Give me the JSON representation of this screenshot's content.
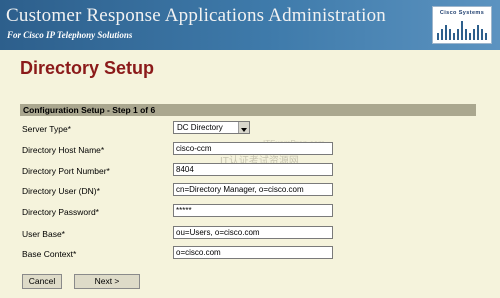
{
  "header": {
    "title": "Customer Response Applications Administration",
    "subtitle": "For Cisco IP Telephony Solutions",
    "logo_text": "Cisco Systems"
  },
  "page_title": "Directory Setup",
  "step_label": "Configuration Setup - Step 1 of 6",
  "form": {
    "server_type": {
      "label": "Server Type*",
      "value": "DC Directory"
    },
    "host_name": {
      "label": "Directory Host Name*",
      "value": "cisco-ccm"
    },
    "port_number": {
      "label": "Directory Port Number*",
      "value": "8404"
    },
    "user_dn": {
      "label": "Directory User (DN)*",
      "value": "cn=Directory Manager, o=cisco.com"
    },
    "password": {
      "label": "Directory Password*",
      "value": "*****"
    },
    "user_base": {
      "label": "User Base*",
      "value": "ou=Users, o=cisco.com"
    },
    "base_context": {
      "label": "Base Context*",
      "value": "o=cisco.com"
    }
  },
  "buttons": {
    "cancel": "Cancel",
    "next": "Next >"
  },
  "watermark": {
    "line1": "ITExamPrep.com",
    "line2": "IT认证考试资源网"
  },
  "colors": {
    "banner": "#3f7bab",
    "page_background": "#f5f3dc",
    "title": "#8b1a1a",
    "step_bar": "#aaa78f"
  }
}
